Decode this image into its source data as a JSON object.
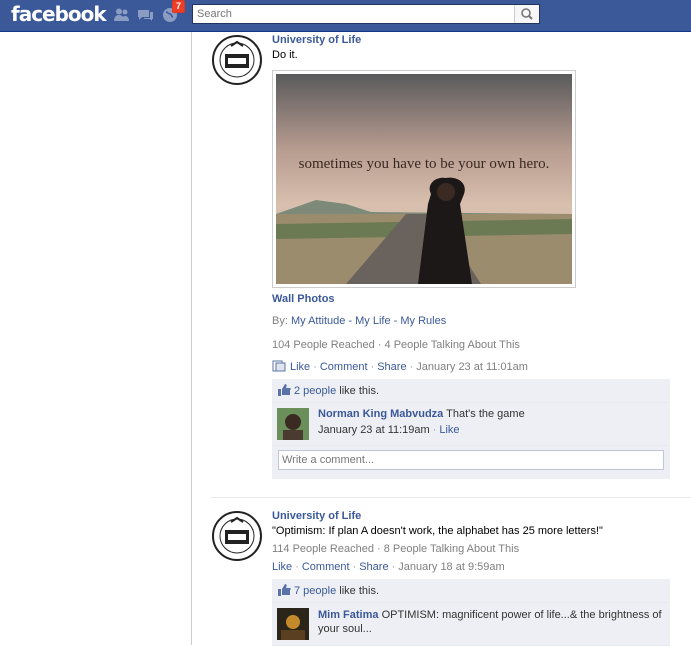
{
  "topbar": {
    "logo": "facebook",
    "notifications_count": "7",
    "search_placeholder": "Search"
  },
  "post1": {
    "author": "University of Life",
    "message": "Do it.",
    "photo_caption": "sometimes you have to be your own hero.",
    "album_title": "Wall Photos",
    "by_label": "By: ",
    "album_by": "My Attitude - My Life - My Rules",
    "stats": "104 People Reached · 4 People Talking About This",
    "like_label": "Like",
    "comment_label": "Comment",
    "share_label": "Share",
    "timestamp": "January 23 at 11:01am",
    "likes_link": "2 people",
    "likes_suffix": " like this.",
    "comment": {
      "author": "Norman King Mabvudza",
      "text": " That's the game",
      "timestamp": "January 23 at 11:19am",
      "like_label": "Like"
    },
    "comment_placeholder": "Write a comment..."
  },
  "post2": {
    "author": "University of Life",
    "message": "\"Optimism: If plan A doesn't work, the alphabet has 25 more letters!\"",
    "stats": "114 People Reached · 8 People Talking About This",
    "like_label": "Like",
    "comment_label": "Comment",
    "share_label": "Share",
    "timestamp": "January 18 at 9:59am",
    "likes_link": "7 people",
    "likes_suffix": " like this.",
    "comment": {
      "author": "Mim Fatima",
      "text": " OPTIMISM: magnificent power of life...& the brightness of your soul..."
    }
  },
  "colors": {
    "brand_blue": "#3b5998",
    "badge_red": "#f03d25",
    "ufi_bg": "#edeff4"
  }
}
